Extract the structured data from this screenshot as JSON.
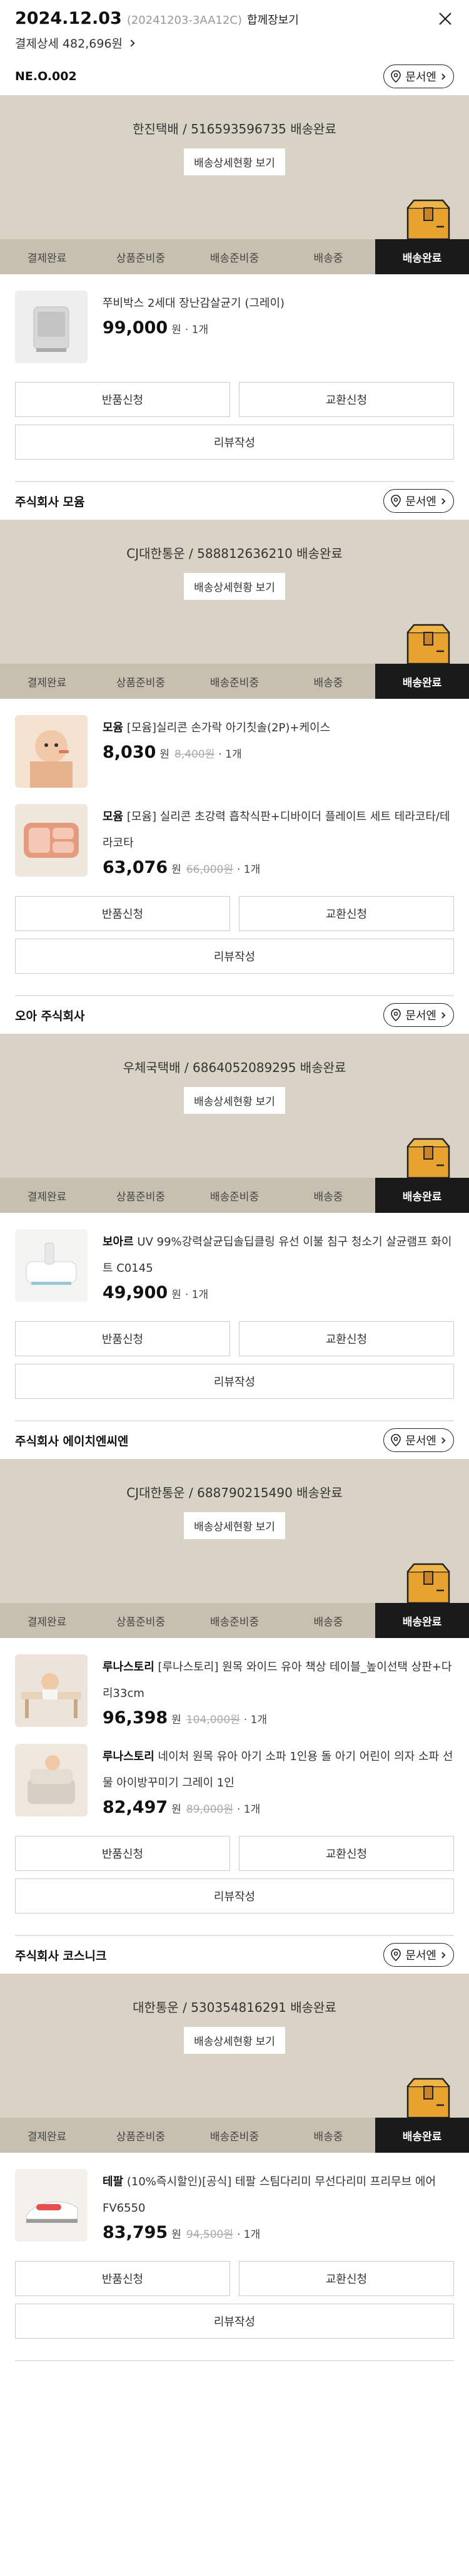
{
  "header": {
    "date": "2024.12.03",
    "order_no": "(20241203-3AA12C)",
    "merged_link": "합께장보기",
    "payment": "결제상세 482,696원"
  },
  "common": {
    "inquiry": "문서엔",
    "track_button": "배송상세현황 보기",
    "steps": [
      "결제완료",
      "상품준비중",
      "배송준비중",
      "배송중",
      "배송완료"
    ],
    "return": "반품신청",
    "exchange": "교환신청",
    "review": "리뷰작성",
    "won": "원",
    "qty": "· 1개"
  },
  "groups": [
    {
      "seller": "NE.O.002",
      "tracking": "한진택배 / 516593596735 배송완료",
      "products": [
        {
          "brand": "",
          "name": "쭈비박스 2세대 장난감살균기 (그레이)",
          "price": "99,000",
          "original": ""
        }
      ]
    },
    {
      "seller": "주식회사 모윰",
      "tracking": "CJ대한통운 / 588812636210 배송완료",
      "products": [
        {
          "brand": "모윰",
          "name": "[모윰]실리콘 손가락 아기칫솔(2P)+케이스",
          "price": "8,030",
          "original": "8,400원"
        },
        {
          "brand": "모윰",
          "name": "[모윰] 실리콘 초강력 흡착식판+디바이더 플레이트 세트 테라코타/테라코타",
          "price": "63,076",
          "original": "66,000원"
        }
      ]
    },
    {
      "seller": "오아 주식회사",
      "tracking": "우체국택배 / 6864052089295 배송완료",
      "products": [
        {
          "brand": "보아르",
          "name": "UV 99%강력살균딥솔딥클링 유선 이불 침구 청소기 살균램프 화이트 C0145",
          "price": "49,900",
          "original": ""
        }
      ]
    },
    {
      "seller": "주식회사 에이치엔씨엔",
      "tracking": "CJ대한통운 / 688790215490 배송완료",
      "products": [
        {
          "brand": "루나스토리",
          "name": "[루나스토리] 원목 와이드 유아 책상 테이블_높이선택 상판+다리33cm",
          "price": "96,398",
          "original": "104,000원"
        },
        {
          "brand": "루나스토리",
          "name": "네이처 원목 유아 아기 소파 1인용 돌 아기 어린이 의자 소파 선물 아이방꾸미기 그레이 1인",
          "price": "82,497",
          "original": "89,000원"
        }
      ]
    },
    {
      "seller": "주식회사 코스니크",
      "tracking": "대한통운 / 530354816291 배송완료",
      "products": [
        {
          "brand": "테팔",
          "name": "(10%즉시할인)[공식] 테팔 스팀다리미 무선다리미 프리무브 에어 FV6550",
          "price": "83,795",
          "original": "94,500원"
        }
      ]
    }
  ],
  "colors": {
    "delivery_bg": "#d9d3c5",
    "steps_bg": "#c7c0b1",
    "active_step": "#1a1a1a"
  }
}
